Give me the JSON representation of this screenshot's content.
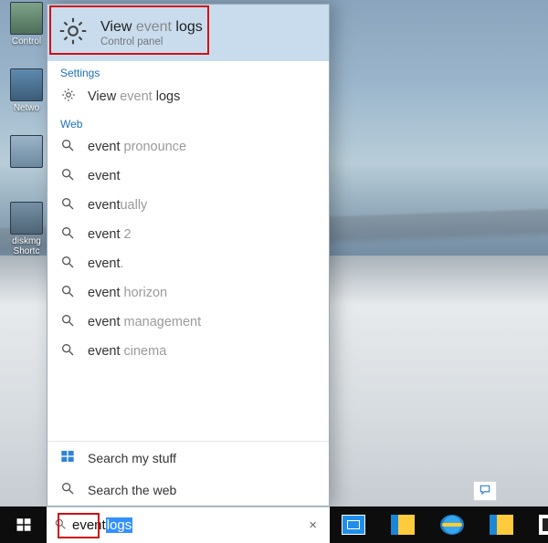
{
  "desktop_icons": [
    {
      "label": "Control"
    },
    {
      "label": "Netwo"
    },
    {
      "label": ""
    },
    {
      "label": "diskmg Shortc"
    }
  ],
  "best_match": {
    "title_prefix": "View ",
    "title_muted": "event",
    "title_suffix": " logs",
    "subtitle": "Control panel"
  },
  "settings_label": "Settings",
  "settings_item": {
    "prefix": "View ",
    "muted": "event",
    "suffix": " logs"
  },
  "web_label": "Web",
  "web_items": [
    {
      "q": "event",
      "rest": "   pronounce"
    },
    {
      "q": "event",
      "rest": ""
    },
    {
      "q": "event",
      "rest": "ually"
    },
    {
      "q": "event",
      "rest": " 2"
    },
    {
      "q": "event",
      "rest": "."
    },
    {
      "q": "event",
      "rest": " horizon"
    },
    {
      "q": "event",
      "rest": " management"
    },
    {
      "q": "event",
      "rest": " cinema"
    }
  ],
  "mystuff_items": [
    {
      "label": "Search my stuff",
      "icon": "windows"
    },
    {
      "label": "Search the web",
      "icon": "search"
    }
  ],
  "search": {
    "typed": "event",
    "selected_suffix": " logs",
    "clear_glyph": "×"
  },
  "colors": {
    "highlight_border": "#d11010",
    "selection_bg": "#3390ff"
  }
}
